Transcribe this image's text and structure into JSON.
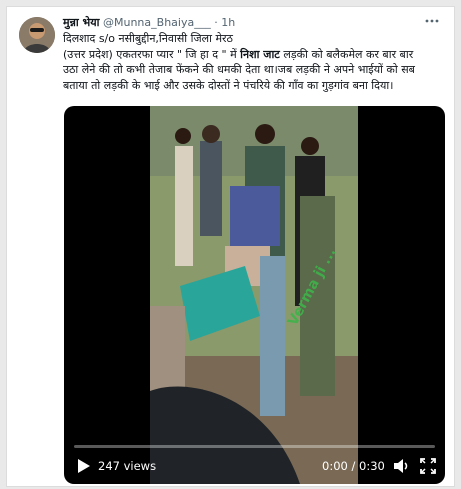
{
  "tweet": {
    "author_name": "मुन्ना भेया",
    "handle": "@Munna_Bhaiya___",
    "separator": "·",
    "time": "1h",
    "text": {
      "line1": "दिलशाद s/o नसीबुद्दीन,निवासी जिला मेरठ",
      "line2_a": "(उत्तर प्रदेश) एकतरफा प्यार \" जि हा द \" में ",
      "line2_b": "निशा जाट",
      "line2_c": " लड़की को बलैकमेल कर बार बार",
      "line3": "उठा लेने की तो कभी तेजाब फेंकने की धमकी देता था।जब लड़की ने अपने भाईयों को सब",
      "line4": "बताया तो लड़की के भाई और उसके दोस्तों ने पंचरिये की गाँव का गुड़गांव बना दिया।"
    }
  },
  "video": {
    "watermark": "Verma ji ...",
    "views": "247 views",
    "time_display": "0:00 / 0:30",
    "progress": 0
  },
  "icons": {
    "more": "more-options-icon",
    "play": "play-icon",
    "volume": "volume-icon",
    "fullscreen": "fullscreen-icon"
  },
  "colors": {
    "text": "#0f1419",
    "secondary": "#536471",
    "watermark": "#3fb34a"
  }
}
